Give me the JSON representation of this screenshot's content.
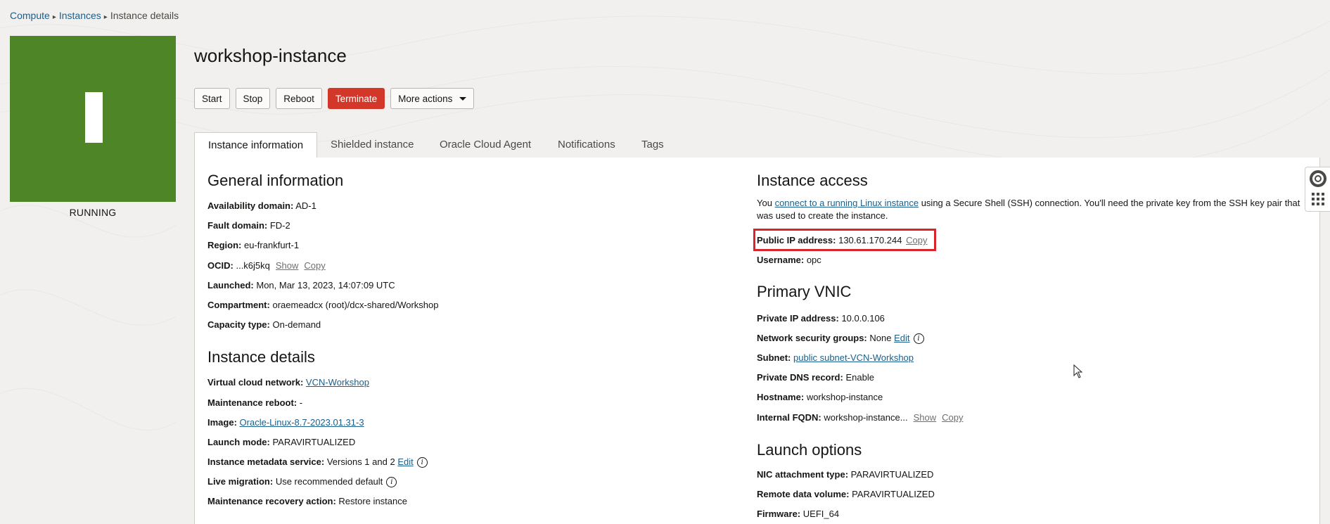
{
  "breadcrumb": {
    "compute": "Compute",
    "instances": "Instances",
    "current": "Instance details",
    "sep_char": "▸"
  },
  "status": {
    "label": "RUNNING",
    "glyph": "I",
    "color": "#4d8527"
  },
  "title": "workshop-instance",
  "actions": {
    "start": "Start",
    "stop": "Stop",
    "reboot": "Reboot",
    "terminate": "Terminate",
    "more": "More actions"
  },
  "tabs": [
    "Instance information",
    "Shielded instance",
    "Oracle Cloud Agent",
    "Notifications",
    "Tags"
  ],
  "general": {
    "title": "General information",
    "availability_domain": {
      "label": "Availability domain:",
      "value": "AD-1"
    },
    "fault_domain": {
      "label": "Fault domain:",
      "value": "FD-2"
    },
    "region": {
      "label": "Region:",
      "value": "eu-frankfurt-1"
    },
    "ocid": {
      "label": "OCID:",
      "value": "...k6j5kq",
      "show": "Show",
      "copy": "Copy"
    },
    "launched": {
      "label": "Launched:",
      "value": "Mon, Mar 13, 2023, 14:07:09 UTC"
    },
    "compartment": {
      "label": "Compartment:",
      "value": "oraemeadcx (root)/dcx-shared/Workshop"
    },
    "capacity_type": {
      "label": "Capacity type:",
      "value": "On-demand"
    }
  },
  "details": {
    "title": "Instance details",
    "vcn": {
      "label": "Virtual cloud network:",
      "value": "VCN-Workshop"
    },
    "maintenance_reboot": {
      "label": "Maintenance reboot:",
      "value": "-"
    },
    "image": {
      "label": "Image:",
      "value": "Oracle-Linux-8.7-2023.01.31-3"
    },
    "launch_mode": {
      "label": "Launch mode:",
      "value": "PARAVIRTUALIZED"
    },
    "metadata_service": {
      "label": "Instance metadata service:",
      "value": "Versions 1 and 2",
      "edit": "Edit"
    },
    "live_migration": {
      "label": "Live migration:",
      "value": "Use recommended default"
    },
    "recovery_action": {
      "label": "Maintenance recovery action:",
      "value": "Restore instance"
    }
  },
  "access": {
    "title": "Instance access",
    "intro_pre": "You ",
    "intro_link": "connect to a running Linux instance",
    "intro_post": " using a Secure Shell (SSH) connection. You'll need the private key from the SSH key pair that was used to create the instance.",
    "public_ip": {
      "label": "Public IP address:",
      "value": "130.61.170.244",
      "copy": "Copy"
    },
    "username": {
      "label": "Username:",
      "value": "opc"
    }
  },
  "vnic": {
    "title": "Primary VNIC",
    "private_ip": {
      "label": "Private IP address:",
      "value": "10.0.0.106"
    },
    "nsg": {
      "label": "Network security groups:",
      "value": "None",
      "edit": "Edit"
    },
    "subnet": {
      "label": "Subnet:",
      "value": "public subnet-VCN-Workshop"
    },
    "dns": {
      "label": "Private DNS record:",
      "value": "Enable"
    },
    "hostname": {
      "label": "Hostname:",
      "value": "workshop-instance"
    },
    "fqdn": {
      "label": "Internal FQDN:",
      "value": "workshop-instance...",
      "show": "Show",
      "copy": "Copy"
    }
  },
  "launch": {
    "title": "Launch options",
    "nic": {
      "label": "NIC attachment type:",
      "value": "PARAVIRTUALIZED"
    },
    "remote_volume": {
      "label": "Remote data volume:",
      "value": "PARAVIRTUALIZED"
    },
    "firmware": {
      "label": "Firmware:",
      "value": "UEFI_64"
    }
  },
  "colors": {
    "accent": "#1b5f8c",
    "danger": "#d2372a",
    "highlight": "#d8242a"
  }
}
